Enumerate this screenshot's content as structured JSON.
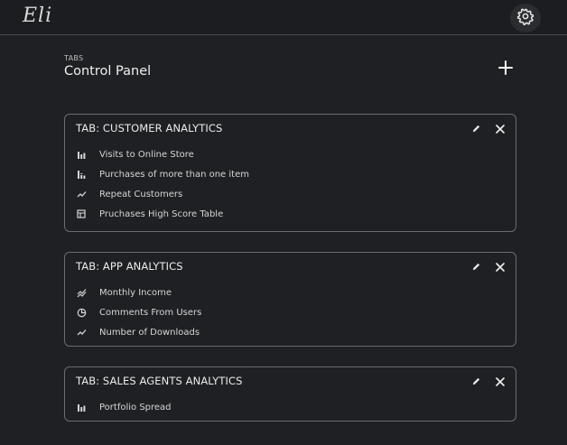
{
  "app": {
    "logo_text": "Eli"
  },
  "header": {
    "overline": "TABS",
    "title": "Control Panel"
  },
  "cards": [
    {
      "title": "TAB: CUSTOMER ANALYTICS",
      "items": [
        {
          "label": "Visits to Online Store",
          "icon": "bar-chart-icon"
        },
        {
          "label": "Purchases of more than one item",
          "icon": "stacked-bar-chart-icon"
        },
        {
          "label": "Repeat Customers",
          "icon": "line-chart-icon"
        },
        {
          "label": "Pruchases High Score Table",
          "icon": "table-icon"
        }
      ]
    },
    {
      "title": "TAB: APP ANALYTICS",
      "items": [
        {
          "label": "Monthly Income",
          "icon": "multiline-chart-icon"
        },
        {
          "label": "Comments From Users",
          "icon": "pie-chart-icon"
        },
        {
          "label": "Number of Downloads",
          "icon": "line-chart-icon"
        }
      ]
    },
    {
      "title": "TAB: SALES AGENTS ANALYTICS",
      "items": [
        {
          "label": "Portfolio Spread",
          "icon": "bar-chart-icon"
        }
      ]
    }
  ],
  "colors": {
    "background": "#1f2023",
    "topbar": "#1c1d20",
    "card_border": "#6a6b6e",
    "text": "#e6e6e6"
  }
}
